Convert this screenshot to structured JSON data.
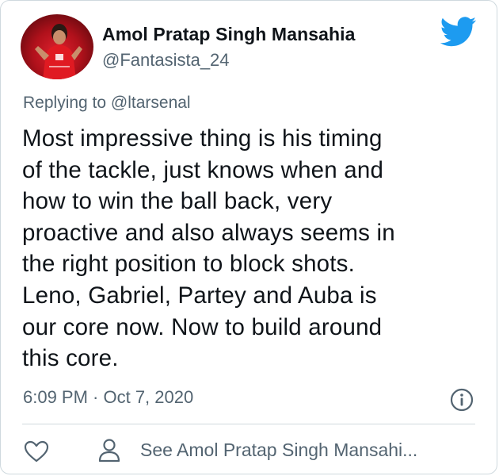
{
  "author": {
    "name": "Amol Pratap Singh Mansahia",
    "handle": "@Fantasista_24"
  },
  "reply_context": "Replying to @ltarsenal",
  "tweet": {
    "text": "Most impressive thing is his timing\nof the tackle, just knows when and\nhow to win the ball back, very\nproactive and also always seems in\nthe right position to block shots.\nLeno, Gabriel, Partey and Auba is\nour core now. Now to build around\nthis core."
  },
  "timestamp": "6:09 PM · Oct 7, 2020",
  "actions": {
    "see_profile_label": "See Amol Pratap Singh Mansahi..."
  },
  "icons": {
    "brand": "twitter-bird-icon",
    "info": "info-icon",
    "like": "heart-icon",
    "profile": "person-icon"
  },
  "colors": {
    "brand_blue": "#1d9bf0",
    "text_primary": "#0f1419",
    "text_secondary": "#536471",
    "avatar_red": "#c8101b"
  }
}
